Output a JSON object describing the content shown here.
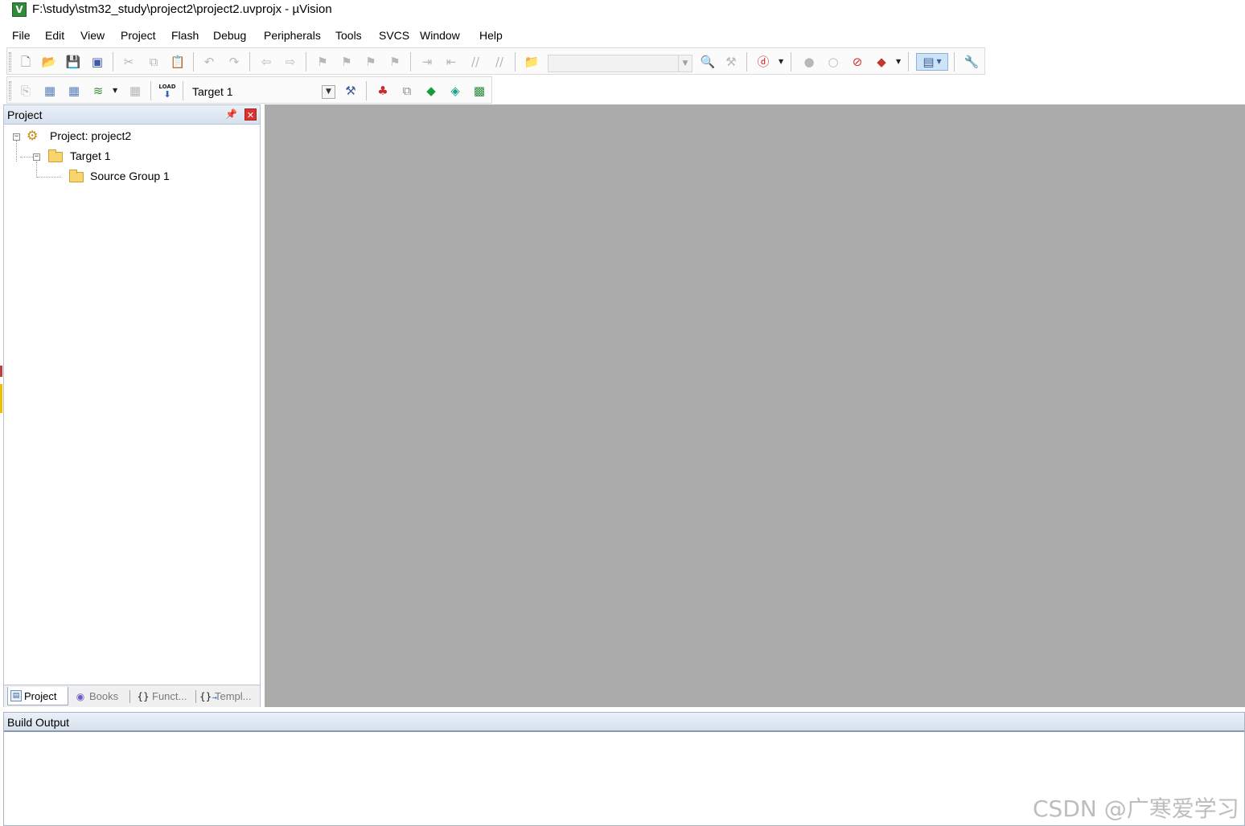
{
  "window": {
    "title": "F:\\study\\stm32_study\\project2\\project2.uvprojx - µVision",
    "app_icon_letter": "V"
  },
  "menu": [
    "File",
    "Edit",
    "View",
    "Project",
    "Flash",
    "Debug",
    "Peripherals",
    "Tools",
    "SVCS",
    "Window",
    "Help"
  ],
  "toolbar_build": {
    "target_select_value": "Target 1",
    "load_label": "LOAD"
  },
  "project_panel": {
    "title": "Project",
    "tree": {
      "project_label": "Project: project2",
      "target_label": "Target 1",
      "group_label": "Source Group 1"
    },
    "tabs": [
      {
        "label": "Project",
        "active": true
      },
      {
        "label": "Books",
        "active": false
      },
      {
        "label": "Funct...",
        "active": false
      },
      {
        "label": "Templ...",
        "active": false
      }
    ]
  },
  "build_output": {
    "title": "Build Output"
  },
  "watermark": "CSDN @广寒爱学习",
  "colors": {
    "editor_background": "#ababab",
    "panel_header": "#d7e1ee",
    "close_button": "#d9332f"
  }
}
